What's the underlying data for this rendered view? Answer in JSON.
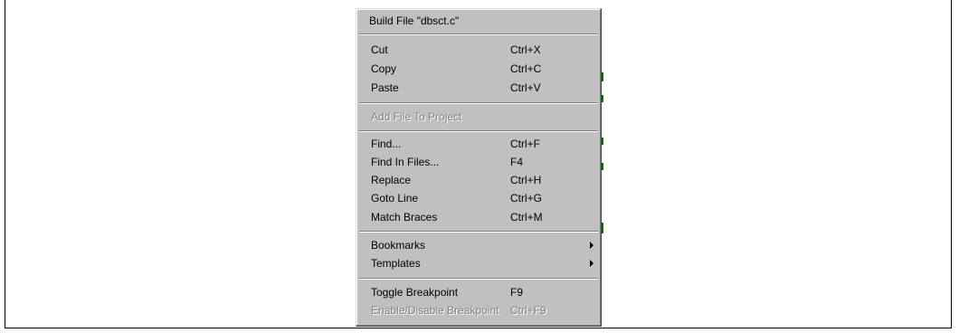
{
  "menu": {
    "build_file": "Build File \"dbsct.c\"",
    "cut": {
      "label": "Cut",
      "shortcut": "Ctrl+X"
    },
    "copy": {
      "label": "Copy",
      "shortcut": "Ctrl+C"
    },
    "paste": {
      "label": "Paste",
      "shortcut": "Ctrl+V"
    },
    "add_file": "Add File To Project",
    "find": {
      "label": "Find...",
      "shortcut": "Ctrl+F"
    },
    "find_in_files": {
      "label": "Find In Files...",
      "shortcut": "F4"
    },
    "replace": {
      "label": "Replace",
      "shortcut": "Ctrl+H"
    },
    "goto_line": {
      "label": "Goto Line",
      "shortcut": "Ctrl+G"
    },
    "match_braces": {
      "label": "Match Braces",
      "shortcut": "Ctrl+M"
    },
    "bookmarks": "Bookmarks",
    "templates": "Templates",
    "toggle_breakpoint": {
      "label": "Toggle Breakpoint",
      "shortcut": "F9"
    },
    "enable_disable_breakpoint": {
      "label": "Enable/Disable Breakpoint",
      "shortcut": "Ctrl+F9"
    }
  },
  "colors": {
    "menu_background": "#c0c0c0",
    "disabled_text": "#808080",
    "artifact_green": "#007000"
  }
}
